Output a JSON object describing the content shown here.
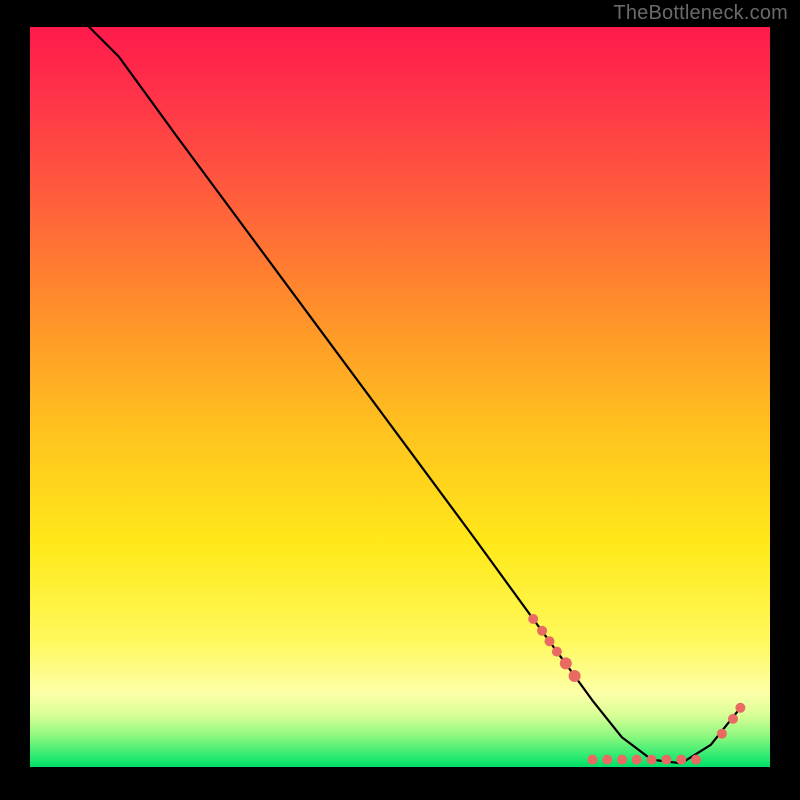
{
  "attribution": "TheBottleneck.com",
  "chart_data": {
    "type": "line",
    "title": "",
    "xlabel": "",
    "ylabel": "",
    "xlim": [
      0,
      100
    ],
    "ylim": [
      0,
      100
    ],
    "grid": false,
    "series": [
      {
        "name": "curve",
        "x": [
          8,
          12,
          20,
          30,
          40,
          50,
          60,
          68,
          72,
          76,
          80,
          84,
          88,
          92,
          96
        ],
        "values": [
          100,
          96,
          85,
          71.5,
          58,
          44.5,
          31,
          20,
          14.5,
          9,
          4,
          1,
          0.5,
          3,
          8
        ],
        "stroke": "#000000",
        "stroke_width": 2.2
      }
    ],
    "markers": [
      {
        "x": 68.0,
        "y": 20.0,
        "r": 5
      },
      {
        "x": 69.2,
        "y": 18.4,
        "r": 5
      },
      {
        "x": 70.2,
        "y": 17.0,
        "r": 5
      },
      {
        "x": 71.2,
        "y": 15.6,
        "r": 5
      },
      {
        "x": 72.4,
        "y": 14.0,
        "r": 6
      },
      {
        "x": 73.6,
        "y": 12.3,
        "r": 6
      },
      {
        "x": 76.0,
        "y": 1.0,
        "r": 5
      },
      {
        "x": 78.0,
        "y": 1.0,
        "r": 5
      },
      {
        "x": 80.0,
        "y": 1.0,
        "r": 5
      },
      {
        "x": 82.0,
        "y": 1.0,
        "r": 5
      },
      {
        "x": 84.0,
        "y": 1.0,
        "r": 5
      },
      {
        "x": 86.0,
        "y": 1.0,
        "r": 5
      },
      {
        "x": 88.0,
        "y": 1.0,
        "r": 5
      },
      {
        "x": 90.0,
        "y": 1.0,
        "r": 5
      },
      {
        "x": 93.5,
        "y": 4.5,
        "r": 5
      },
      {
        "x": 95.0,
        "y": 6.5,
        "r": 5
      },
      {
        "x": 96.0,
        "y": 8.0,
        "r": 5
      }
    ],
    "marker_color": "#e86a63"
  }
}
